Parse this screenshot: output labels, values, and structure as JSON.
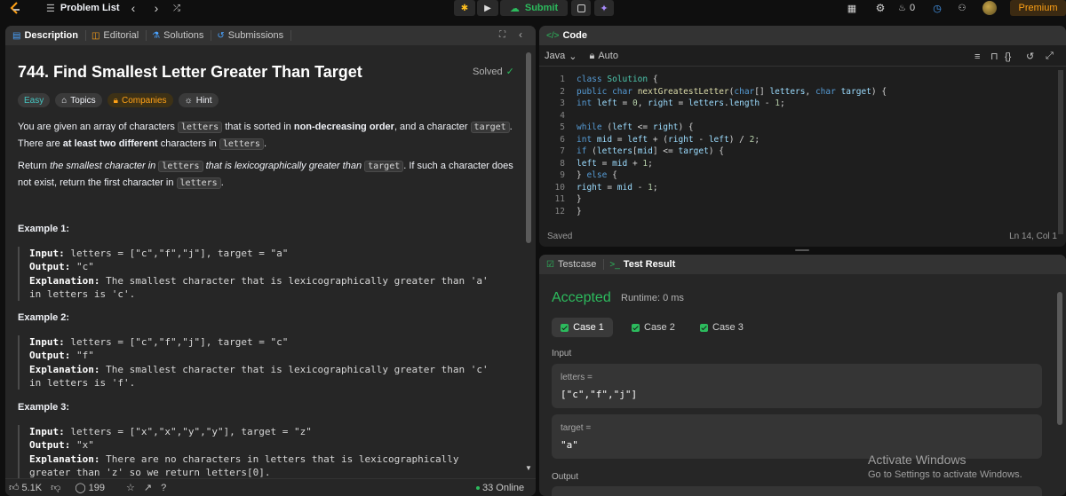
{
  "topbar": {
    "title": "Problem List",
    "prev_icon": "chevron-left-icon",
    "next_icon": "chevron-right-icon",
    "shuffle_icon": "shuffle-icon",
    "submit_label": "Submit",
    "streak_count": "0",
    "premium_label": "Premium",
    "colors": {
      "submit": "#2cbb5d",
      "premium": "#ffa116"
    }
  },
  "left": {
    "tabs": [
      "Description",
      "Editorial",
      "Solutions",
      "Submissions"
    ],
    "problem_title": "744. Find Smallest Letter Greater Than Target",
    "solved_label": "Solved",
    "tags": {
      "difficulty": "Easy",
      "topics": "Topics",
      "companies": "Companies",
      "hint": "Hint"
    },
    "para1": {
      "t1": "You are given an array of characters ",
      "c1": "letters",
      "t2": " that is sorted in ",
      "b1": "non-decreasing order",
      "t3": ", and a character ",
      "c2": "target",
      "t4": ". There are ",
      "b2": "at least two different",
      "t5": " characters in ",
      "c3": "letters",
      "t6": "."
    },
    "para2": {
      "t1": "Return ",
      "i1": "the smallest character in ",
      "c1": "letters",
      "i2": " that is lexicographically greater than ",
      "c2": "target",
      "t2": ". If such a character does not exist, return the first character in ",
      "c3": "letters",
      "t3": "."
    },
    "examples": [
      {
        "title": "Example 1:",
        "input": "letters = [\"c\",\"f\",\"j\"], target = \"a\"",
        "output": "\"c\"",
        "explanation": "The smallest character that is lexicographically greater than 'a' in letters is 'c'."
      },
      {
        "title": "Example 2:",
        "input": "letters = [\"c\",\"f\",\"j\"], target = \"c\"",
        "output": "\"f\"",
        "explanation": "The smallest character that is lexicographically greater than 'c' in letters is 'f'."
      },
      {
        "title": "Example 3:",
        "input": "letters = [\"x\",\"x\",\"y\",\"y\"], target = \"z\"",
        "output": "\"x\"",
        "explanation": "There are no characters in letters that is lexicographically greater than 'z' so we return letters[0]."
      }
    ],
    "labels": {
      "input": "Input:",
      "output": "Output:",
      "explanation": "Explanation:"
    },
    "footer": {
      "likes": "5.1K",
      "comments": "199",
      "online": "33 Online"
    }
  },
  "code": {
    "header": "Code",
    "language": "Java",
    "auto_label": "Auto",
    "saved_label": "Saved",
    "cursor_pos": "Ln 14, Col 1"
  },
  "results": {
    "tab_testcase": "Testcase",
    "tab_result": "Test Result",
    "status": "Accepted",
    "runtime": "Runtime: 0 ms",
    "cases": [
      "Case 1",
      "Case 2",
      "Case 3"
    ],
    "input_label": "Input",
    "var1_name": "letters =",
    "var1_value": "[\"c\",\"f\",\"j\"]",
    "var2_name": "target =",
    "var2_value": "\"a\"",
    "output_label": "Output",
    "watermark_title": "Activate Windows",
    "watermark_sub": "Go to Settings to activate Windows.",
    "colors": {
      "accepted": "#2cbb5d"
    }
  }
}
